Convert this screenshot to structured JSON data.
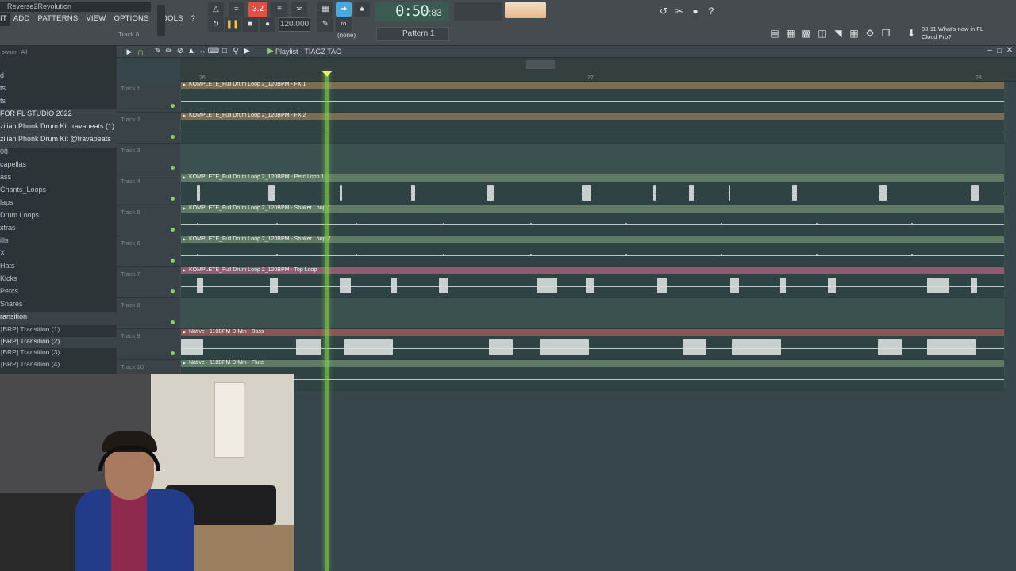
{
  "menubar": {
    "hint": "Reverse2Revolution",
    "items": [
      "IT",
      "ADD",
      "PATTERNS",
      "VIEW",
      "OPTIONS",
      "TOOLS",
      "?"
    ],
    "track_label": "Track 8"
  },
  "transport": {
    "time": "0:50",
    "time_fraction": ":83",
    "time_unit": "M:S:CS",
    "counter": "3.2",
    "tempo": "120.000",
    "pattern_select": "(none)",
    "pattern": "Pattern 1"
  },
  "news": {
    "date": "03-11",
    "line1": "What's new in FL",
    "line2": "Cloud Pro?"
  },
  "browser": {
    "header": "owser - All",
    "items": [
      {
        "label": "d",
        "selected": false
      },
      {
        "label": "ts",
        "selected": false
      },
      {
        "label": "ts",
        "selected": false
      },
      {
        "label": " FOR FL STUDIO 2022",
        "selected": true
      },
      {
        "label": "zilian Phonk Drum Kit travabeats (1)",
        "selected": true
      },
      {
        "label": "zilian Phonk Drum Kit @travabeats",
        "selected": true
      },
      {
        "label": "08",
        "selected": false
      },
      {
        "label": "capellas",
        "selected": false
      },
      {
        "label": "ass",
        "selected": false
      },
      {
        "label": "Chants_Loops",
        "selected": false
      },
      {
        "label": "laps",
        "selected": false
      },
      {
        "label": "Drum Loops",
        "selected": false
      },
      {
        "label": "xtras",
        "selected": false
      },
      {
        "label": "ills",
        "selected": false
      },
      {
        "label": "X",
        "selected": false
      },
      {
        "label": "Hats",
        "selected": false
      },
      {
        "label": "Kicks",
        "selected": false
      },
      {
        "label": "Percs",
        "selected": false
      },
      {
        "label": "Snares",
        "selected": false
      },
      {
        "label": "ransition",
        "selected": true
      }
    ],
    "sub_items": [
      " [BRP] Transition (1)",
      " [BRP] Transition (2)",
      " [BRP] Transition (3)",
      " [BRP] Transition (4)"
    ]
  },
  "playlist": {
    "title": "Playlist - TIAGZ TAG",
    "bars": [
      "26",
      "27",
      "28"
    ],
    "tracks": [
      {
        "name": "Track 1",
        "clip": "KOMPLETE_Full Drum Loop 2_120BPM - FX 1",
        "color": "#7a6d55"
      },
      {
        "name": "Track 2",
        "clip": "KOMPLETE_Full Drum Loop 2_120BPM - FX 2",
        "color": "#7a6d55"
      },
      {
        "name": "Track 3",
        "clip": "",
        "color": ""
      },
      {
        "name": "Track 4",
        "clip": "KOMPLETE_Full Drum Loop 2_120BPM - Perc Loop 1",
        "color": "#5f7a65"
      },
      {
        "name": "Track 5",
        "clip": "KOMPLETE_Full Drum Loop 2_120BPM - Shaker Loop 1",
        "color": "#5f7a65"
      },
      {
        "name": "Track 6",
        "clip": "KOMPLETE_Full Drum Loop 2_120BPM - Shaker Loop 2",
        "color": "#5f7a65"
      },
      {
        "name": "Track 7",
        "clip": "KOMPLETE_Full Drum Loop 2_120BPM - Top Loop",
        "color": "#8a5d70"
      },
      {
        "name": "Track 8",
        "clip": "",
        "color": ""
      },
      {
        "name": "Track 9",
        "clip": "Native - 110BPM D Min - Bass",
        "color": "#8a5555"
      },
      {
        "name": "Track 10",
        "clip": "Native - 110BPM D Min - Flute",
        "color": "#5f7a65"
      }
    ]
  },
  "colors": {
    "accent": "#4aa9d8",
    "playhead": "#84d64a",
    "time_display": "#3b5a51"
  },
  "icons": [
    "play-icon",
    "stop-icon",
    "record-icon",
    "loop-icon",
    "pencil-icon",
    "magnet-icon",
    "help-icon",
    "mixer-icon",
    "browser-icon"
  ]
}
